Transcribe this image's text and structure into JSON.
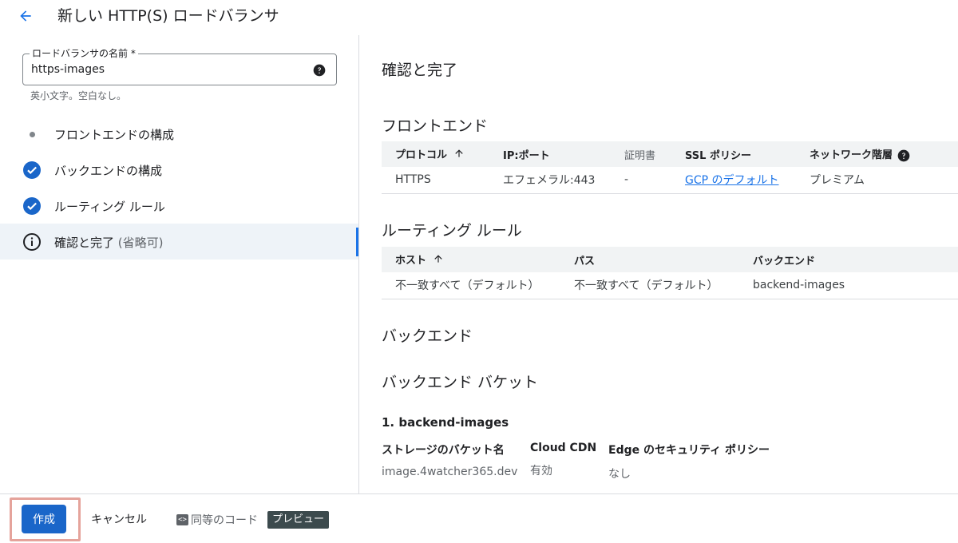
{
  "header": {
    "title": "新しい HTTP(S) ロードバランサ"
  },
  "colors": {
    "accent": "#1a73e8",
    "primary_button": "#1a66c9",
    "highlight_outline": "#e5a39b",
    "active_step_bg": "#eef3f8",
    "preview_badge_bg": "#3c4a4d"
  },
  "form": {
    "name_label": "ロードバランサの名前 *",
    "name_value": "https-images",
    "name_hint": "英小文字。空白なし。"
  },
  "steps": [
    {
      "label": "フロントエンドの構成",
      "status": "pending",
      "icon": "dot-icon"
    },
    {
      "label": "バックエンドの構成",
      "status": "complete",
      "icon": "check-circle-icon"
    },
    {
      "label": "ルーティング ルール",
      "status": "complete",
      "icon": "check-circle-icon"
    },
    {
      "label": "確認と完了",
      "optional": "(省略可)",
      "status": "active",
      "icon": "info-icon"
    }
  ],
  "review": {
    "title": "確認と完了",
    "frontend": {
      "title": "フロントエンド",
      "columns": [
        "プロトコル",
        "IP:ポート",
        "証明書",
        "SSL ポリシー",
        "ネットワーク階層"
      ],
      "rows": [
        {
          "protocol": "HTTPS",
          "ip_port": "エフェメラル:443",
          "certificate": "-",
          "ssl_policy": "GCP のデフォルト",
          "network_tier": "プレミアム"
        }
      ]
    },
    "routing": {
      "title": "ルーティング ルール",
      "columns": [
        "ホスト",
        "パス",
        "バックエンド"
      ],
      "rows": [
        {
          "host": "不一致すべて（デフォルト）",
          "path": "不一致すべて（デフォルト）",
          "backend": "backend-images"
        }
      ]
    },
    "backend": {
      "title": "バックエンド",
      "bucket_section_title": "バックエンド バケット",
      "bucket": {
        "title": "1. backend-images",
        "columns": [
          "ストレージのバケット名",
          "Cloud CDN",
          "Edge のセキュリティ ポリシー"
        ],
        "values": [
          "image.4watcher365.dev",
          "有効",
          "なし"
        ]
      }
    }
  },
  "footer": {
    "create_label": "作成",
    "cancel_label": "キャンセル",
    "code_label": "同等のコード",
    "preview_label": "プレビュー"
  }
}
